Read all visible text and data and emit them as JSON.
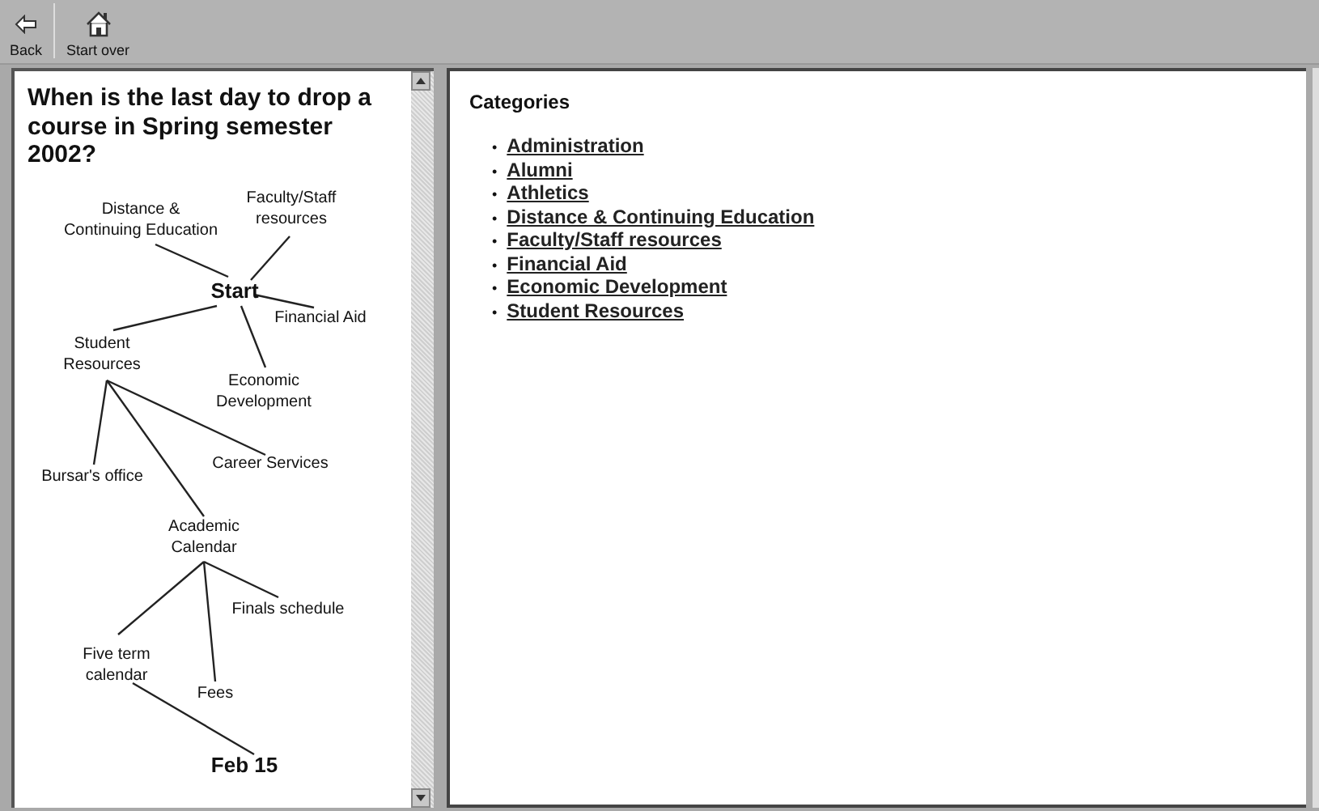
{
  "toolbar": {
    "buttons": [
      {
        "label": "Back",
        "kind": "back"
      },
      {
        "label": "Start over",
        "kind": "home"
      }
    ]
  },
  "question": "When is the last day to drop a course in Spring semester 2002?",
  "map": {
    "root": {
      "lines": [
        "Start"
      ],
      "emphasis": true,
      "children": [
        {
          "lines": [
            "Distance &",
            "Continuing Education"
          ],
          "emphasis": false
        },
        {
          "lines": [
            "Faculty/Staff",
            "resources"
          ],
          "emphasis": false
        },
        {
          "lines": [
            "Financial Aid"
          ],
          "emphasis": false
        },
        {
          "lines": [
            "Student",
            "Resources"
          ],
          "emphasis": false,
          "children": [
            {
              "lines": [
                "Bursar's office"
              ],
              "emphasis": false
            },
            {
              "lines": [
                "Career Services"
              ],
              "emphasis": false
            },
            {
              "lines": [
                "Academic",
                "Calendar"
              ],
              "emphasis": false,
              "children": [
                {
                  "lines": [
                    "Finals schedule"
                  ],
                  "emphasis": false
                },
                {
                  "lines": [
                    "Five term",
                    "calendar"
                  ],
                  "emphasis": false,
                  "children": [
                    {
                      "lines": [
                        "Feb 15"
                      ],
                      "emphasis": true
                    }
                  ]
                },
                {
                  "lines": [
                    "Fees"
                  ],
                  "emphasis": false
                }
              ]
            }
          ]
        },
        {
          "lines": [
            "Economic",
            "Development"
          ],
          "emphasis": false
        }
      ]
    }
  },
  "categories": {
    "title": "Categories",
    "links": [
      {
        "bullet": "•",
        "label": "Administration"
      },
      {
        "bullet": "•",
        "label": "Alumni"
      },
      {
        "bullet": "•",
        "label": "Athletics"
      },
      {
        "bullet": "•",
        "label": "Distance & Continuing Education"
      },
      {
        "bullet": "•",
        "label": "Faculty/Staff resources"
      },
      {
        "bullet": "•",
        "label": "Financial Aid"
      },
      {
        "bullet": "•",
        "label": "Economic Development"
      },
      {
        "bullet": "•",
        "label": "Student Resources"
      }
    ]
  }
}
